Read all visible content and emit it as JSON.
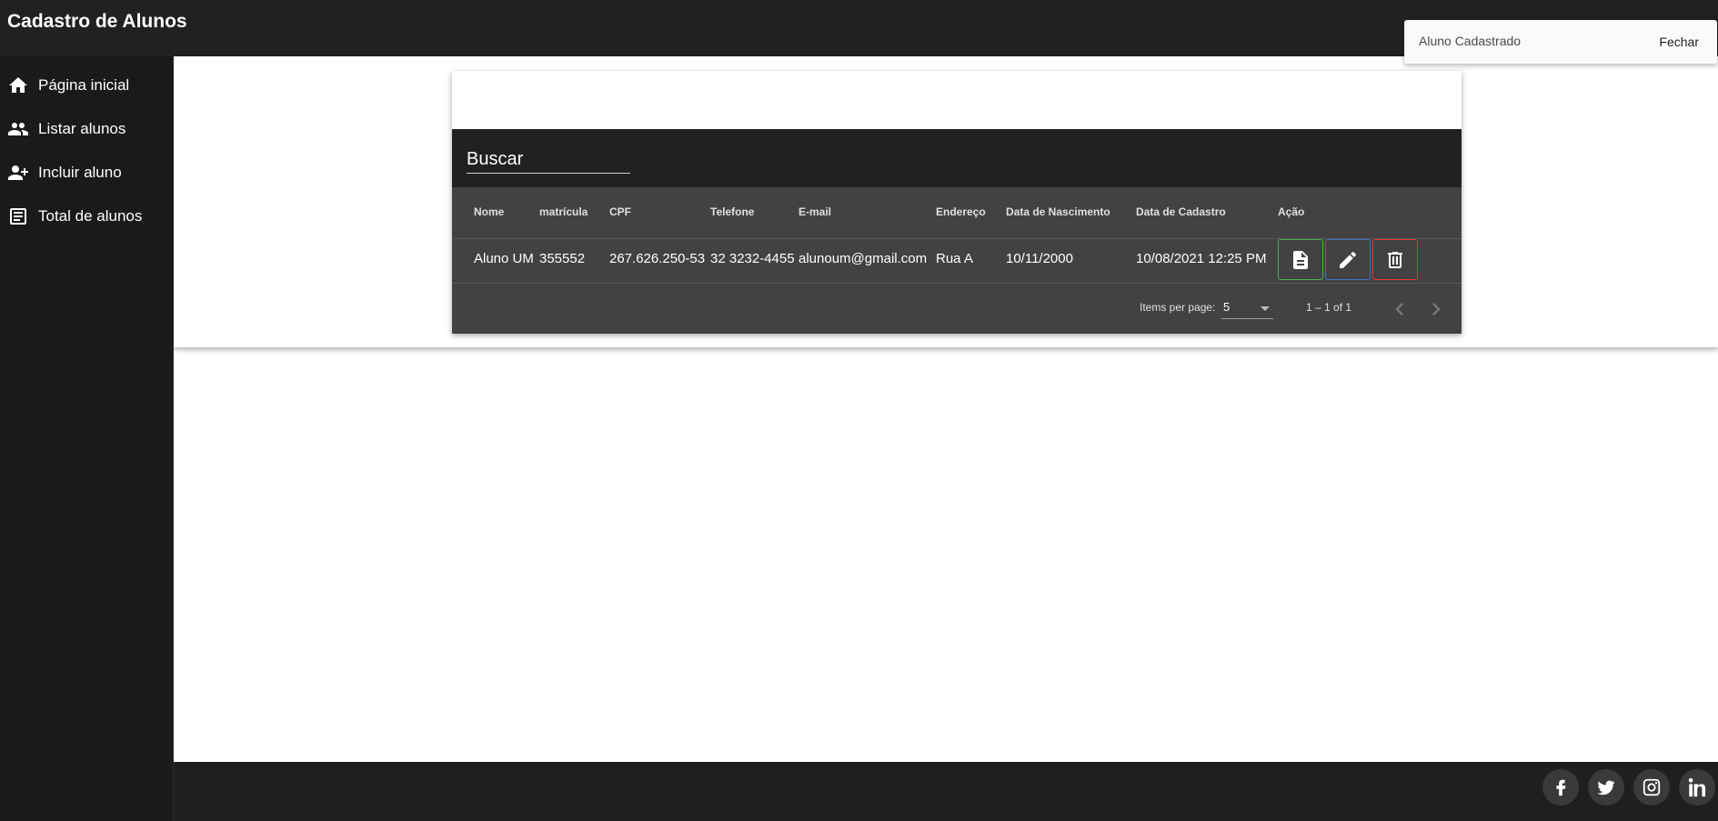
{
  "header": {
    "title": "Cadastro de Alunos"
  },
  "sidebar": {
    "items": [
      {
        "label": "Página inicial",
        "icon": "home-icon"
      },
      {
        "label": "Listar alunos",
        "icon": "people-icon"
      },
      {
        "label": "Incluir aluno",
        "icon": "person-add-icon"
      },
      {
        "label": "Total de alunos",
        "icon": "list-alt-icon"
      }
    ]
  },
  "search": {
    "placeholder": "Buscar"
  },
  "table": {
    "columns": [
      "Nome",
      "matrícula",
      "CPF",
      "Telefone",
      "E-mail",
      "Endereço",
      "Data de Nascimento",
      "Data de Cadastro",
      "Ação"
    ],
    "rows": [
      {
        "nome": "Aluno UM",
        "matricula": "355552",
        "cpf": "267.626.250-53",
        "telefone": "32 3232-4455",
        "email": "alunoum@gmail.com",
        "endereco": "Rua A",
        "nascimento": "10/11/2000",
        "cadastro": "10/08/2021 12:25 PM"
      }
    ],
    "actions": [
      {
        "name": "view",
        "icon": "document-icon",
        "color": "#4caf50"
      },
      {
        "name": "edit",
        "icon": "pencil-icon",
        "color": "#3f6fd6"
      },
      {
        "name": "delete",
        "icon": "trash-icon",
        "color": "#e53935"
      }
    ]
  },
  "pagination": {
    "items_per_page_label": "Items per page:",
    "items_per_page_value": "5",
    "range": "1 – 1 of 1"
  },
  "snackbar": {
    "message": "Aluno Cadastrado",
    "action": "Fechar"
  },
  "footer": {
    "social": [
      "facebook-icon",
      "twitter-icon",
      "instagram-icon",
      "linkedin-icon"
    ]
  }
}
